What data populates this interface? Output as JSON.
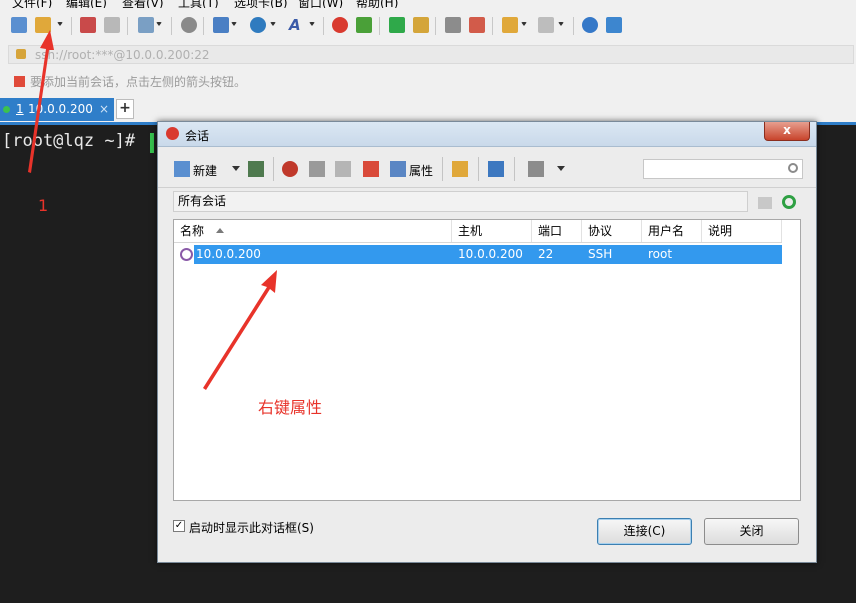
{
  "menu": [
    "文件(F)",
    "编辑(E)",
    "查看(V)",
    "工具(T)",
    "选项卡(B)",
    "窗口(W)",
    "帮助(H)"
  ],
  "address": {
    "value": "ssh://root:***@10.0.0.200:22"
  },
  "hint": {
    "text": "要添加当前会话，点击左侧的箭头按钮。"
  },
  "tabs": [
    {
      "index": "1",
      "label": "10.0.0.200",
      "close": "×"
    }
  ],
  "tab_add": "+",
  "terminal": {
    "prompt": "[root@lqz ~]#"
  },
  "dialog": {
    "title": "会话",
    "close": "x",
    "toolbar": {
      "new_label": "新建",
      "props_label": "属性"
    },
    "folder": "所有会话",
    "columns": [
      "名称",
      "主机",
      "端口",
      "协议",
      "用户名",
      "说明"
    ],
    "rows": [
      {
        "name": "10.0.0.200",
        "host": "10.0.0.200",
        "port": "22",
        "protocol": "SSH",
        "user": "root",
        "desc": ""
      }
    ],
    "show_on_startup": {
      "label": "启动时显示此对话框(S)",
      "checked": true,
      "mark": "✓"
    },
    "buttons": {
      "connect": "连接(C)",
      "close": "关闭"
    }
  },
  "annotations": {
    "num": "1",
    "note": "右键属性"
  },
  "colors": {
    "accent": "#2f7ec9",
    "selection": "#3399ee",
    "annotation": "#e8332a",
    "terminal_bg": "#1e1e1e"
  }
}
